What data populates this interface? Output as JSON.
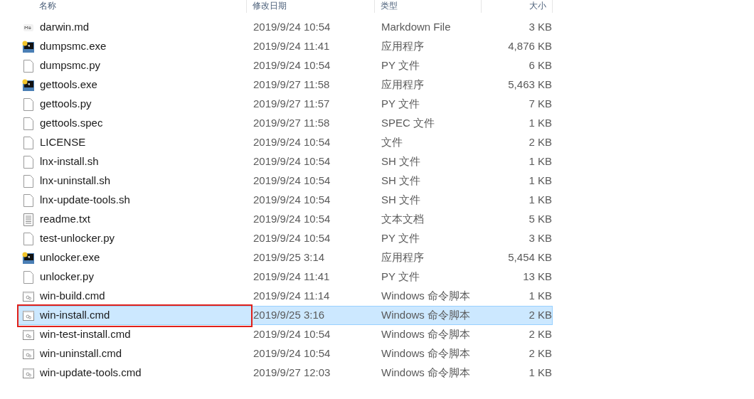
{
  "columns": [
    {
      "label": "名称"
    },
    {
      "label": "修改日期"
    },
    {
      "label": "类型"
    },
    {
      "label": "大小"
    }
  ],
  "files": [
    {
      "name": "darwin.md",
      "date": "2019/9/24 10:54",
      "type": "Markdown File",
      "size": "3 KB",
      "kind": "md",
      "selected": false,
      "highlighted": false
    },
    {
      "name": "dumpsmc.exe",
      "date": "2019/9/24 11:41",
      "type": "应用程序",
      "size": "4,876 KB",
      "kind": "exe",
      "selected": false,
      "highlighted": false
    },
    {
      "name": "dumpsmc.py",
      "date": "2019/9/24 10:54",
      "type": "PY 文件",
      "size": "6 KB",
      "kind": "file",
      "selected": false,
      "highlighted": false
    },
    {
      "name": "gettools.exe",
      "date": "2019/9/27 11:58",
      "type": "应用程序",
      "size": "5,463 KB",
      "kind": "exe",
      "selected": false,
      "highlighted": false
    },
    {
      "name": "gettools.py",
      "date": "2019/9/27 11:57",
      "type": "PY 文件",
      "size": "7 KB",
      "kind": "file",
      "selected": false,
      "highlighted": false
    },
    {
      "name": "gettools.spec",
      "date": "2019/9/27 11:58",
      "type": "SPEC 文件",
      "size": "1 KB",
      "kind": "file",
      "selected": false,
      "highlighted": false
    },
    {
      "name": "LICENSE",
      "date": "2019/9/24 10:54",
      "type": "文件",
      "size": "2 KB",
      "kind": "file",
      "selected": false,
      "highlighted": false
    },
    {
      "name": "lnx-install.sh",
      "date": "2019/9/24 10:54",
      "type": "SH 文件",
      "size": "1 KB",
      "kind": "file",
      "selected": false,
      "highlighted": false
    },
    {
      "name": "lnx-uninstall.sh",
      "date": "2019/9/24 10:54",
      "type": "SH 文件",
      "size": "1 KB",
      "kind": "file",
      "selected": false,
      "highlighted": false
    },
    {
      "name": "lnx-update-tools.sh",
      "date": "2019/9/24 10:54",
      "type": "SH 文件",
      "size": "1 KB",
      "kind": "file",
      "selected": false,
      "highlighted": false
    },
    {
      "name": "readme.txt",
      "date": "2019/9/24 10:54",
      "type": "文本文档",
      "size": "5 KB",
      "kind": "txt",
      "selected": false,
      "highlighted": false
    },
    {
      "name": "test-unlocker.py",
      "date": "2019/9/24 10:54",
      "type": "PY 文件",
      "size": "3 KB",
      "kind": "file",
      "selected": false,
      "highlighted": false
    },
    {
      "name": "unlocker.exe",
      "date": "2019/9/25 3:14",
      "type": "应用程序",
      "size": "5,454 KB",
      "kind": "exe",
      "selected": false,
      "highlighted": false
    },
    {
      "name": "unlocker.py",
      "date": "2019/9/24 11:41",
      "type": "PY 文件",
      "size": "13 KB",
      "kind": "file",
      "selected": false,
      "highlighted": false
    },
    {
      "name": "win-build.cmd",
      "date": "2019/9/24 11:14",
      "type": "Windows 命令脚本",
      "size": "1 KB",
      "kind": "cmd",
      "selected": false,
      "highlighted": false
    },
    {
      "name": "win-install.cmd",
      "date": "2019/9/25 3:16",
      "type": "Windows 命令脚本",
      "size": "2 KB",
      "kind": "cmd",
      "selected": true,
      "highlighted": true
    },
    {
      "name": "win-test-install.cmd",
      "date": "2019/9/24 10:54",
      "type": "Windows 命令脚本",
      "size": "2 KB",
      "kind": "cmd",
      "selected": false,
      "highlighted": false
    },
    {
      "name": "win-uninstall.cmd",
      "date": "2019/9/24 10:54",
      "type": "Windows 命令脚本",
      "size": "2 KB",
      "kind": "cmd",
      "selected": false,
      "highlighted": false
    },
    {
      "name": "win-update-tools.cmd",
      "date": "2019/9/27 12:03",
      "type": "Windows 命令脚本",
      "size": "1 KB",
      "kind": "cmd",
      "selected": false,
      "highlighted": false
    }
  ]
}
